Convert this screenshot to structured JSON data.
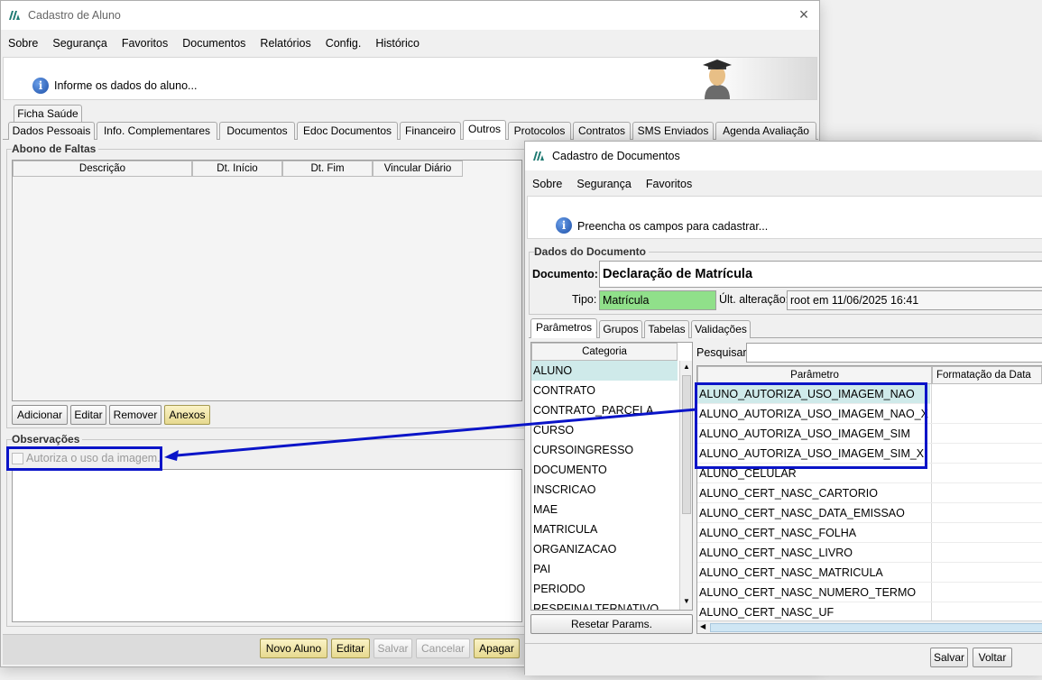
{
  "aluno_window": {
    "title": "Cadastro de Aluno",
    "menu": [
      "Sobre",
      "Segurança",
      "Favoritos",
      "Documentos",
      "Relatórios",
      "Config.",
      "Histórico"
    ],
    "banner_text": "Informe os dados do aluno...",
    "tabs_row1": [
      "Ficha Saúde"
    ],
    "tabs_row2": [
      "Dados Pessoais",
      "Info. Complementares",
      "Documentos",
      "Edoc Documentos",
      "Financeiro",
      "Outros",
      "Protocolos",
      "Contratos",
      "SMS Enviados",
      "Agenda Avaliação"
    ],
    "selected_tab": "Outros",
    "abono": {
      "label": "Abono de Faltas",
      "columns": [
        "Descrição",
        "Dt. Início",
        "Dt. Fim",
        "Vincular Diário"
      ],
      "buttons": [
        "Adicionar",
        "Editar",
        "Remover",
        "Anexos"
      ]
    },
    "observacoes": {
      "label": "Observações",
      "checkbox_label": "Autoriza o uso da imagem.",
      "checked": false
    },
    "footer_buttons": [
      "Novo Aluno",
      "Editar",
      "Salvar",
      "Cancelar",
      "Apagar"
    ]
  },
  "doc_window": {
    "title": "Cadastro de Documentos",
    "menu": [
      "Sobre",
      "Segurança",
      "Favoritos"
    ],
    "banner_text": "Preencha os campos para cadastrar...",
    "dados_label": "Dados do Documento",
    "documento_label": "Documento:",
    "documento_value": "Declaração de Matrícula",
    "tipo_label": "Tipo:",
    "tipo_value": "Matrícula",
    "ult_alteracao_label": "Últ. alteração:",
    "ult_alteracao_value": "root em 11/06/2025 16:41",
    "tabs": [
      "Parâmetros",
      "Grupos",
      "Tabelas",
      "Validações"
    ],
    "selected_tab": "Parâmetros",
    "categoria_header": "Categoria",
    "categorias": [
      "ALUNO",
      "CONTRATO",
      "CONTRATO_PARCELA",
      "CURSO",
      "CURSOINGRESSO",
      "DOCUMENTO",
      "INSCRICAO",
      "MAE",
      "MATRICULA",
      "ORGANIZACAO",
      "PAI",
      "PERIODO",
      "RESPFINALTERNATIVO"
    ],
    "selected_categoria": "ALUNO",
    "resetar_label": "Resetar Params.",
    "pesquisar_label": "Pesquisar:",
    "param_columns": [
      "Parâmetro",
      "Formatação da Data"
    ],
    "parametros": [
      "ALUNO_AUTORIZA_USO_IMAGEM_NAO",
      "ALUNO_AUTORIZA_USO_IMAGEM_NAO_X",
      "ALUNO_AUTORIZA_USO_IMAGEM_SIM",
      "ALUNO_AUTORIZA_USO_IMAGEM_SIM_X",
      "ALUNO_CELULAR",
      "ALUNO_CERT_NASC_CARTORIO",
      "ALUNO_CERT_NASC_DATA_EMISSAO",
      "ALUNO_CERT_NASC_FOLHA",
      "ALUNO_CERT_NASC_LIVRO",
      "ALUNO_CERT_NASC_MATRICULA",
      "ALUNO_CERT_NASC_NUMERO_TERMO",
      "ALUNO_CERT_NASC_UF"
    ],
    "footer_buttons": [
      "Salvar",
      "Voltar"
    ]
  },
  "colors": {
    "annotation": "#0a14c8",
    "selection": "#cfeaea",
    "tipo_bg": "#90e08a",
    "yellow_button": "#efe3a4"
  }
}
